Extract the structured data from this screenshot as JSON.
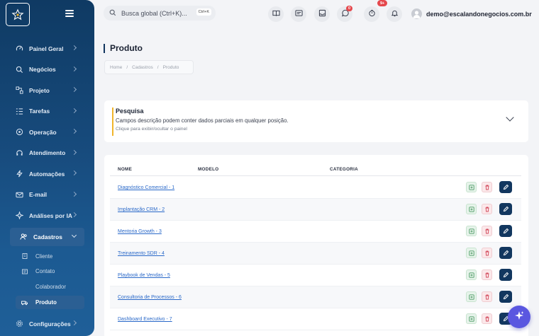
{
  "search": {
    "placeholder": "Busca global (Ctrl+K)...",
    "shortcut": "Ctrl+K"
  },
  "topbar": {
    "icons": [
      "book-icon",
      "card-icon",
      "inbox-icon",
      "whatsapp-icon",
      "timer-icon",
      "bell-icon"
    ],
    "whatsapp_badge": "0",
    "timer_badge": "9+",
    "user_email": "demo@escalandonegocios.com.br"
  },
  "sidebar": {
    "items": [
      {
        "label": "Painel Geral",
        "icon": "gauge-icon"
      },
      {
        "label": "Negócios",
        "icon": "search-icon"
      },
      {
        "label": "Projeto",
        "icon": "nodes-icon"
      },
      {
        "label": "Tarefas",
        "icon": "list-icon"
      },
      {
        "label": "Operação",
        "icon": "satellite-icon"
      },
      {
        "label": "Atendimento",
        "icon": "headset-icon"
      },
      {
        "label": "Automações",
        "icon": "bolt-icon"
      },
      {
        "label": "E-mail",
        "icon": "mail-icon"
      },
      {
        "label": "Análises por IA",
        "icon": "sparkle-icon"
      },
      {
        "label": "Cadastros",
        "icon": "users-icon"
      }
    ],
    "subitems": [
      {
        "label": "Cliente"
      },
      {
        "label": "Contato"
      },
      {
        "label": "Colaborador"
      },
      {
        "label": "Produto"
      }
    ],
    "settings_label": "Configurações"
  },
  "page": {
    "title": "Produto",
    "breadcrumb": [
      "Home",
      "Cadastros",
      "Produto"
    ]
  },
  "search_panel": {
    "title": "Pesquisa",
    "description": "Campos descrição podem conter dados parciais em qualquer posição.",
    "hint": "Clique para exibir/ocultar o painel"
  },
  "table": {
    "headers": [
      "NOME",
      "MODELO",
      "CATEGORIA"
    ],
    "rows": [
      {
        "name": "Diagnóstico Comercial - 1"
      },
      {
        "name": "Implantação CRM - 2"
      },
      {
        "name": "Mentoria Growth - 3"
      },
      {
        "name": "Treinamento SDR - 4"
      },
      {
        "name": "Playbook de Vendas - 5"
      },
      {
        "name": "Consultoria de Processos - 6"
      },
      {
        "name": "Dashboard Executivo - 7"
      }
    ]
  },
  "colors": {
    "sidebar": "#174b7d",
    "accent": "#f1b52b",
    "edit": "#12375f",
    "link": "#2a69c9",
    "fab": "#5a57e0"
  }
}
